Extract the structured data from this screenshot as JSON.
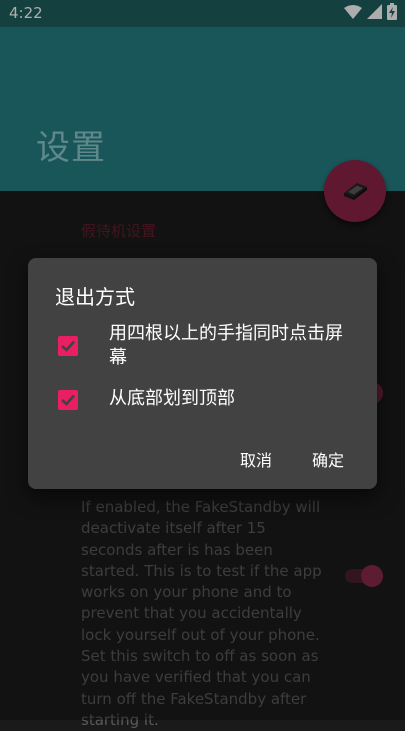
{
  "status_bar": {
    "time": "4:22",
    "icons": [
      "wifi-icon",
      "signal-icon",
      "battery-charging-icon"
    ]
  },
  "header": {
    "title": "设置"
  },
  "background": {
    "section_label": "假待机设置",
    "description": "If enabled, the FakeStandby will deactivate itself after 15 seconds after is has been started. This is to test if the app works on your phone and to prevent that you accidentally lock yourself out of your phone. Set this switch to off as soon as you have verified that you can turn off the FakeStandby after starting it."
  },
  "dialog": {
    "title": "退出方式",
    "options": [
      {
        "label": "用四根以上的手指同时点击屏幕",
        "checked": true
      },
      {
        "label": "从底部划到顶部",
        "checked": true
      }
    ],
    "cancel_label": "取消",
    "confirm_label": "确定"
  },
  "colors": {
    "header": "#267f84",
    "accent": "#e91e63",
    "fab": "#8e2248",
    "dialog": "#424242"
  }
}
